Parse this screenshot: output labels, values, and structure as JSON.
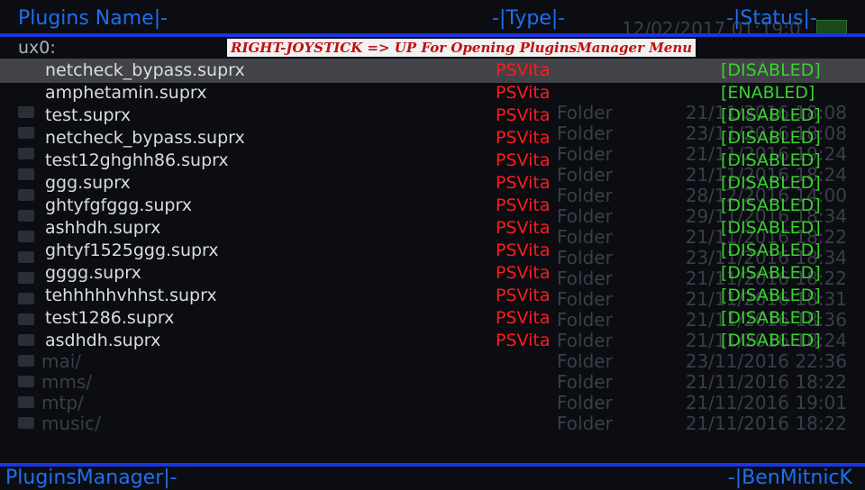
{
  "header": {
    "col_name": "Plugins Name|-",
    "col_type": "-|Type|-",
    "col_status": "-|Status|-",
    "background_date": "12/02/2017 01:19:0"
  },
  "banner": {
    "text": "RIGHT-JOYSTICK => UP For Opening PluginsManager Menu"
  },
  "mount": {
    "label": "ux0:"
  },
  "plugins": [
    {
      "name": "netcheck_bypass.suprx",
      "type": "PSVita",
      "status": "[DISABLED]",
      "selected": true
    },
    {
      "name": "amphetamin.suprx",
      "type": "PSVita",
      "status": "[ENABLED]"
    },
    {
      "name": "test.suprx",
      "type": "PSVita",
      "status": "[DISABLED]"
    },
    {
      "name": "netcheck_bypass.suprx",
      "type": "PSVita",
      "status": "[DISABLED]"
    },
    {
      "name": "test12ghghh86.suprx",
      "type": "PSVita",
      "status": "[DISABLED]"
    },
    {
      "name": "ggg.suprx",
      "type": "PSVita",
      "status": "[DISABLED]"
    },
    {
      "name": "ghtyfgfggg.suprx",
      "type": "PSVita",
      "status": "[DISABLED]"
    },
    {
      "name": "ashhdh.suprx",
      "type": "PSVita",
      "status": "[DISABLED]"
    },
    {
      "name": "ghtyf1525ggg.suprx",
      "type": "PSVita",
      "status": "[DISABLED]"
    },
    {
      "name": "gggg.suprx",
      "type": "PSVita",
      "status": "[DISABLED]"
    },
    {
      "name": "tehhhhhvhhst.suprx",
      "type": "PSVita",
      "status": "[DISABLED]"
    },
    {
      "name": "test1286.suprx",
      "type": "PSVita",
      "status": "[DISABLED]"
    },
    {
      "name": "asdhdh.suprx",
      "type": "PSVita",
      "status": "[DISABLED]"
    }
  ],
  "background_files": [
    {
      "name": "",
      "type": "Folder",
      "date": "21/11/2016 18:08"
    },
    {
      "name": "",
      "type": "Folder",
      "date": "23/11/2016 18:08"
    },
    {
      "name": "",
      "type": "Folder",
      "date": "21/11/2016 19:24"
    },
    {
      "name": "",
      "type": "Folder",
      "date": "21/11/2016 18:24"
    },
    {
      "name": "",
      "type": "Folder",
      "date": "28/12/2016 14:00"
    },
    {
      "name": "",
      "type": "Folder",
      "date": "29/11/2016 18:34"
    },
    {
      "name": "",
      "type": "Folder",
      "date": "21/11/2016 18:22"
    },
    {
      "name": "",
      "type": "Folder",
      "date": "23/11/2016 18:34"
    },
    {
      "name": "",
      "type": "Folder",
      "date": "21/11/2016 18:22"
    },
    {
      "name": "",
      "type": "Folder",
      "date": "21/11/2016 18:31"
    },
    {
      "name": "",
      "type": "Folder",
      "date": "21/11/2016 18:36"
    },
    {
      "name": "",
      "type": "Folder",
      "date": "21/11/2016 18:24"
    },
    {
      "name": "mai/",
      "type": "Folder",
      "date": "23/11/2016 22:36"
    },
    {
      "name": "mms/",
      "type": "Folder",
      "date": "21/11/2016 18:22"
    },
    {
      "name": "mtp/",
      "type": "Folder",
      "date": "21/11/2016 19:01"
    },
    {
      "name": "music/",
      "type": "Folder",
      "date": "21/11/2016 18:22"
    }
  ],
  "footer": {
    "left": "PluginsManager|-",
    "right": "-|BenMitnicK"
  },
  "colors": {
    "accent_blue": "#1e6ff0",
    "line_blue": "#1a35e6",
    "type_red": "#ff1b1b",
    "status_green": "#3ad22c"
  }
}
